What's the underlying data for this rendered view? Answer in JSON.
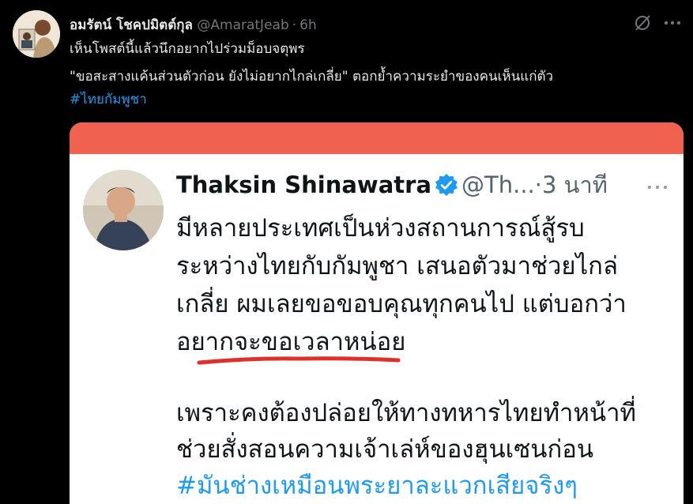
{
  "tweet": {
    "display_name": "อมรัตน์ โชคปมิตต์กุล",
    "handle": "@AmaratJeab",
    "separator": "·",
    "time": "6h",
    "lines": [
      "เห็นโพสต์นี้แล้วนึกอยากไปร่วมม็อบจตุพร",
      "\"ขอสะสางแค้นส่วนตัวก่อน ยังไม่อยากไกล่เกลี่ย\" ตอกย้ำความระยำของคนเห็นแก่ตัว"
    ],
    "hashtag": "#ไทยกัมพูชา"
  },
  "media": {
    "display_name": "Thaksin Shinawatra",
    "handle": "@Th...",
    "separator": "·",
    "time": "3 นาที",
    "lines": [
      "มีหลายประเทศเป็นห่วงสถานการณ์สู้รบ",
      "ระหว่างไทยกับกัมพูชา เสนอตัวมาช่วยไกล่",
      "เกลี่ย ผมเลยขอขอบคุณทุกคนไป แต่บอกว่า",
      "อยากจะขอเวลาหน่อย",
      "เพราะคงต้องปล่อยให้ทางทหารไทยทำหน้าที่",
      "ช่วยสั่งสอนความเจ้าเล่ห์ของฮุนเซนก่อน"
    ],
    "hashtag": "#มันช่างเหมือนพระยาละแวกเสียจริงๆ"
  },
  "colors": {
    "background": "#000000",
    "text": "#e7e9ea",
    "muted": "#71767b",
    "link": "#1d9bf0",
    "red_bar": "#f06150",
    "underline": "#e0302a",
    "verified": "#1d9bf0"
  },
  "icons": [
    "grok-icon",
    "more-icon",
    "verified-badge-icon"
  ]
}
